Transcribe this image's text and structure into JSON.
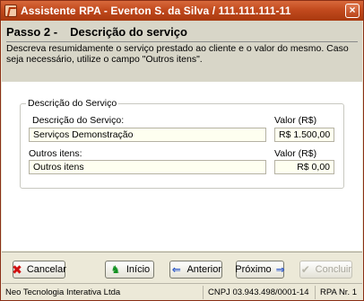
{
  "window": {
    "title": "Assistente RPA - Everton S. da Silva / 111.111.111-11",
    "close_glyph": "×"
  },
  "header": {
    "step": "Passo 2 -",
    "title": "Descrição do serviço",
    "instructions": "Descreva resumidamente o serviço prestado ao cliente e o valor do mesmo. Caso seja necessário, utilize o campo \"Outros itens\"."
  },
  "group": {
    "legend": "Descrição do Serviço",
    "servico_label": "Descrição do Serviço:",
    "servico_value": "Serviços Demonstração",
    "valor_label_1": "Valor (R$)",
    "valor_value_1": "R$ 1.500,00",
    "outros_label": "Outros itens:",
    "outros_value": "Outros itens",
    "valor_label_2": "Valor (R$)",
    "valor_value_2": "R$ 0,00"
  },
  "buttons": {
    "cancelar": "Cancelar",
    "inicio": "Início",
    "anterior": "Anterior",
    "proximo": "Próximo",
    "concluir": "Concluir"
  },
  "icons": {
    "cancel": "✖",
    "home": "♞",
    "left": "⇐",
    "right": "⇒",
    "check": "✔"
  },
  "status": {
    "company": "Neo Tecnologia Interativa Ltda",
    "cnpj": "CNPJ 03.943.498/0001-14",
    "rpa": "RPA Nr. 1"
  }
}
